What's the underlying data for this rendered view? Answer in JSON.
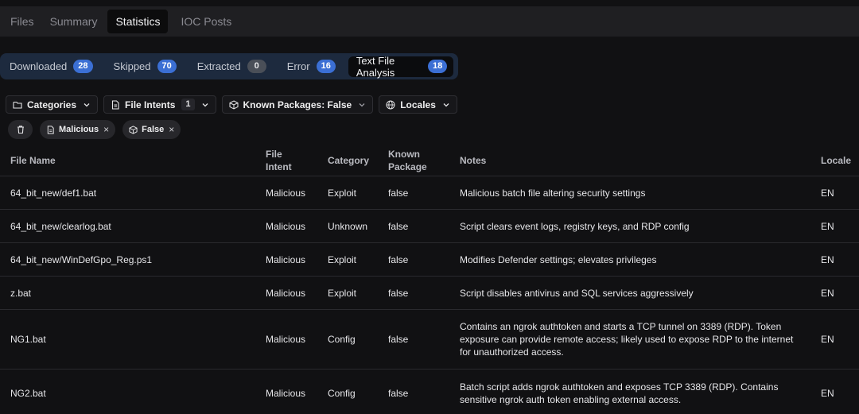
{
  "top_tabs": [
    "Files",
    "Summary",
    "Statistics",
    "IOC Posts"
  ],
  "counters": [
    {
      "label": "Downloaded",
      "count": "28"
    },
    {
      "label": "Skipped",
      "count": "70"
    },
    {
      "label": "Extracted",
      "count": "0"
    },
    {
      "label": "Error",
      "count": "16"
    },
    {
      "label": "Text File Analysis",
      "count": "18"
    }
  ],
  "filters": {
    "categories": "Categories",
    "file_intents": "File Intents",
    "file_intents_count": "1",
    "known_packages": "Known Packages: False",
    "locales": "Locales"
  },
  "chips": {
    "malicious": "Malicious",
    "false": "False",
    "close": "×"
  },
  "table": {
    "headers": {
      "file_name": "File Name",
      "file_intent_1": "File",
      "file_intent_2": "Intent",
      "category": "Category",
      "known_1": "Known",
      "known_2": "Package",
      "notes": "Notes",
      "locale": "Locale"
    },
    "rows": [
      {
        "file": "64_bit_new/def1.bat",
        "intent": "Malicious",
        "category": "Exploit",
        "known": "false",
        "notes": "Malicious batch file altering security settings",
        "locale": "EN"
      },
      {
        "file": "64_bit_new/clearlog.bat",
        "intent": "Malicious",
        "category": "Unknown",
        "known": "false",
        "notes": "Script clears event logs, registry keys, and RDP config",
        "locale": "EN"
      },
      {
        "file": "64_bit_new/WinDefGpo_Reg.ps1",
        "intent": "Malicious",
        "category": "Exploit",
        "known": "false",
        "notes": "Modifies Defender settings; elevates privileges",
        "locale": "EN"
      },
      {
        "file": "z.bat",
        "intent": "Malicious",
        "category": "Exploit",
        "known": "false",
        "notes": "Script disables antivirus and SQL services aggressively",
        "locale": "EN"
      },
      {
        "file": "NG1.bat",
        "intent": "Malicious",
        "category": "Config",
        "known": "false",
        "notes": "Contains an ngrok authtoken and starts a TCP tunnel on 3389 (RDP). Token exposure can provide remote access; likely used to expose RDP to the internet for unauthorized access.",
        "locale": "EN"
      },
      {
        "file": "NG2.bat",
        "intent": "Malicious",
        "category": "Config",
        "known": "false",
        "notes": "Batch script adds ngrok authtoken and exposes TCP 3389 (RDP). Contains sensitive ngrok auth token enabling external access.",
        "locale": "EN"
      }
    ]
  }
}
